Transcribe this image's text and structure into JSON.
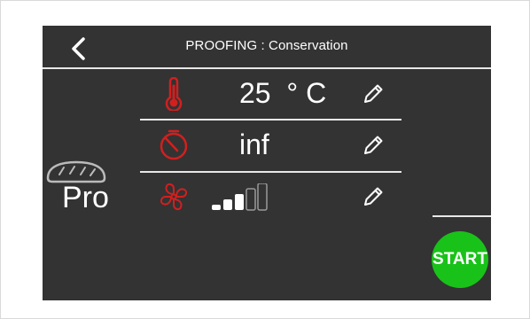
{
  "header": {
    "title": "PROOFING : Conservation",
    "back_icon": "chevron-left-icon"
  },
  "program": {
    "label": "Pro",
    "icon": "bread-icon"
  },
  "settings": [
    {
      "name": "temperature",
      "icon": "thermometer-icon",
      "value": "25  ° C",
      "edit_icon": "pencil-icon"
    },
    {
      "name": "time",
      "icon": "timer-icon",
      "value": "inf",
      "edit_icon": "pencil-icon"
    },
    {
      "name": "fan",
      "icon": "fan-icon",
      "level": 3,
      "max_level": 5,
      "edit_icon": "pencil-icon"
    }
  ],
  "actions": {
    "start_label": "START"
  },
  "colors": {
    "screen_bg": "#333333",
    "accent_red": "#d21f1f",
    "start_green": "#19c219",
    "text": "#ffffff"
  }
}
